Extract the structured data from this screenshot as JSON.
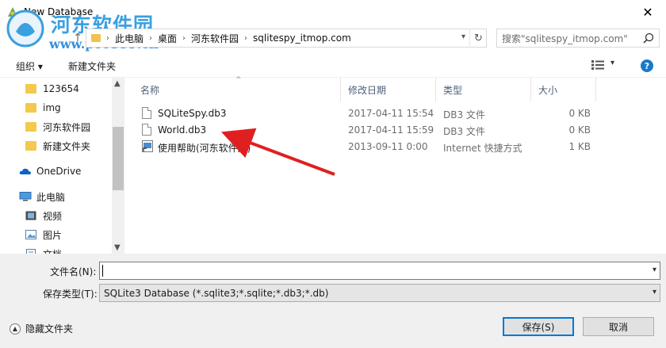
{
  "window": {
    "title": "New Database",
    "close_glyph": "✕"
  },
  "watermark": {
    "text": "河东软件园",
    "url": "www.pc0359.cn"
  },
  "address": {
    "crumbs": [
      "此电脑",
      "桌面",
      "河东软件园",
      "sqlitespy_itmop.com"
    ],
    "search_placeholder": "搜索\"sqlitespy_itmop.com\""
  },
  "toolbar": {
    "organize": "组织 ▾",
    "new_folder": "新建文件夹",
    "help": "?"
  },
  "navpane": {
    "folders": [
      "123654",
      "img",
      "河东软件园",
      "新建文件夹"
    ],
    "onedrive": "OneDrive",
    "this_pc": "此电脑",
    "videos": "视频",
    "pictures": "图片",
    "documents": "文档"
  },
  "filelist": {
    "columns": {
      "name": "名称",
      "modified": "修改日期",
      "type": "类型",
      "size": "大小"
    },
    "rows": [
      {
        "name": "SQLiteSpy.db3",
        "modified": "2017-04-11 15:54",
        "type": "DB3 文件",
        "size": "0 KB"
      },
      {
        "name": "World.db3",
        "modified": "2017-04-11 15:59",
        "type": "DB3 文件",
        "size": "0 KB"
      },
      {
        "name": "使用帮助(河东软件园)",
        "modified": "2013-09-11 0:00",
        "type": "Internet 快捷方式",
        "size": "1 KB"
      }
    ]
  },
  "bottom": {
    "filename_label": "文件名(N):",
    "filename_value": "",
    "filetype_label": "保存类型(T):",
    "filetype_value": "SQLite3 Database (*.sqlite3;*.sqlite;*.db3;*.db)",
    "hide_folders": "隐藏文件夹",
    "save": "保存(S)",
    "cancel": "取消"
  },
  "colors": {
    "accent": "#0078d7",
    "folder": "#f3c94e",
    "arrow": "#e02020"
  }
}
